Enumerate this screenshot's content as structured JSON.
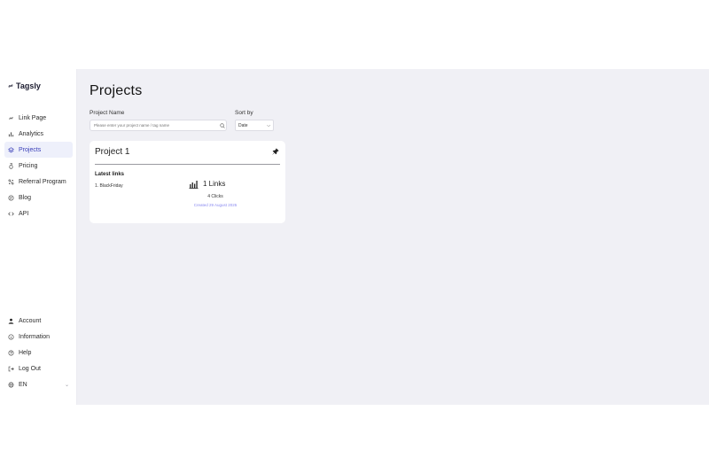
{
  "app": {
    "logo_text": "Tagsly"
  },
  "sidebar": {
    "items": [
      {
        "label": "Link Page",
        "icon": "link-icon"
      },
      {
        "label": "Analytics",
        "icon": "bar-chart-icon"
      },
      {
        "label": "Projects",
        "icon": "layers-icon",
        "active": true
      },
      {
        "label": "Pricing",
        "icon": "money-bag-icon"
      },
      {
        "label": "Referral Program",
        "icon": "share-icon"
      },
      {
        "label": "Blog",
        "icon": "blog-icon"
      },
      {
        "label": "API",
        "icon": "code-icon"
      }
    ],
    "bottom_items": [
      {
        "label": "Account",
        "icon": "user-icon"
      },
      {
        "label": "Information",
        "icon": "info-icon"
      },
      {
        "label": "Help",
        "icon": "help-icon"
      },
      {
        "label": "Log Out",
        "icon": "logout-icon"
      },
      {
        "label": "EN",
        "icon": "globe-icon"
      }
    ]
  },
  "main": {
    "title": "Projects",
    "project_name_label": "Project Name",
    "search_placeholder": "Please enter your project name / tag name",
    "sort_label": "Sort by",
    "sort_value": "Date",
    "project_card": {
      "title": "Project 1",
      "latest_links_label": "Latest links",
      "latest_links": [
        "1. BlackFriday"
      ],
      "links_count": "1 Links",
      "clicks": "4 Clicks",
      "created": "Created 29 August 2025"
    }
  },
  "colors": {
    "accent": "#3a3fb8",
    "created_text": "#8b8bf0",
    "main_bg": "#f0f0f5"
  }
}
